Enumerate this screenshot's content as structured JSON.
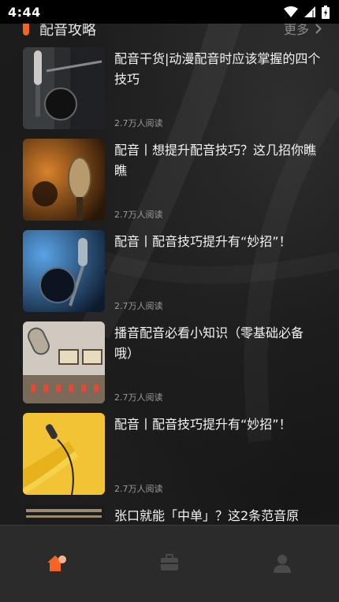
{
  "status_bar": {
    "time": "4:44",
    "icons": [
      "wifi-icon",
      "signal-icon",
      "battery-icon"
    ]
  },
  "section": {
    "title": "配音攻略",
    "more_label": "更多",
    "accent_color": "#f26522"
  },
  "articles": [
    {
      "title": "配音干货|动漫配音时应该掌握的四个技巧",
      "reads": "2.7万人阅读",
      "thumb": "studio-microphone"
    },
    {
      "title": "配音丨想提升配音技巧？这几招你瞧瞧",
      "reads": "2.7万人阅读",
      "thumb": "warm-microphone"
    },
    {
      "title": "配音丨配音技巧提升有“妙招”！",
      "reads": "2.7万人阅读",
      "thumb": "blue-microphone"
    },
    {
      "title": "播音配音必看小知识（零基础必备哦）",
      "reads": "2.7万人阅读",
      "thumb": "mic-and-mixer"
    },
    {
      "title": "配音丨配音技巧提升有“妙招”！",
      "reads": "2.7万人阅读",
      "thumb": "hand-microphone-yellow"
    },
    {
      "title": "张口就能「中单」？这2条范音原",
      "reads": "",
      "thumb": "mixing-console"
    }
  ],
  "tab_bar": {
    "tabs": [
      {
        "icon": "home-icon",
        "active": true
      },
      {
        "icon": "briefcase-icon",
        "active": false
      },
      {
        "icon": "user-icon",
        "active": false
      }
    ],
    "active_color": "#f26522",
    "inactive_color": "#4a4a4a"
  }
}
